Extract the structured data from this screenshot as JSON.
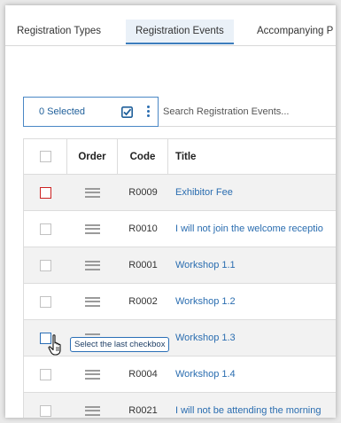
{
  "tabs": [
    {
      "label": "Registration Types",
      "active": false
    },
    {
      "label": "Registration Events",
      "active": true
    },
    {
      "label": "Accompanying P",
      "active": false
    }
  ],
  "toolbar": {
    "selected_label": "0 Selected",
    "check_icon": "check-square-icon",
    "menu_icon": "kebab-menu-icon",
    "search_placeholder": "Search Registration Events..."
  },
  "table": {
    "columns": [
      "",
      "Order",
      "Code",
      "Title"
    ],
    "rows": [
      {
        "code": "R0009",
        "title": "Exhibitor Fee"
      },
      {
        "code": "R0010",
        "title": "I will not join the welcome receptio"
      },
      {
        "code": "R0001",
        "title": "Workshop 1.1"
      },
      {
        "code": "R0002",
        "title": "Workshop 1.2"
      },
      {
        "code": "",
        "title": "Workshop 1.3"
      },
      {
        "code": "R0004",
        "title": "Workshop 1.4"
      },
      {
        "code": "R0021",
        "title": "I will not be attending the morning"
      }
    ]
  },
  "tooltip": {
    "text": "Select the last checkbox"
  },
  "colors": {
    "accent": "#2a6db0",
    "highlight_checkbox": "#cc2222",
    "hover_checkbox": "#2b6fb6"
  }
}
